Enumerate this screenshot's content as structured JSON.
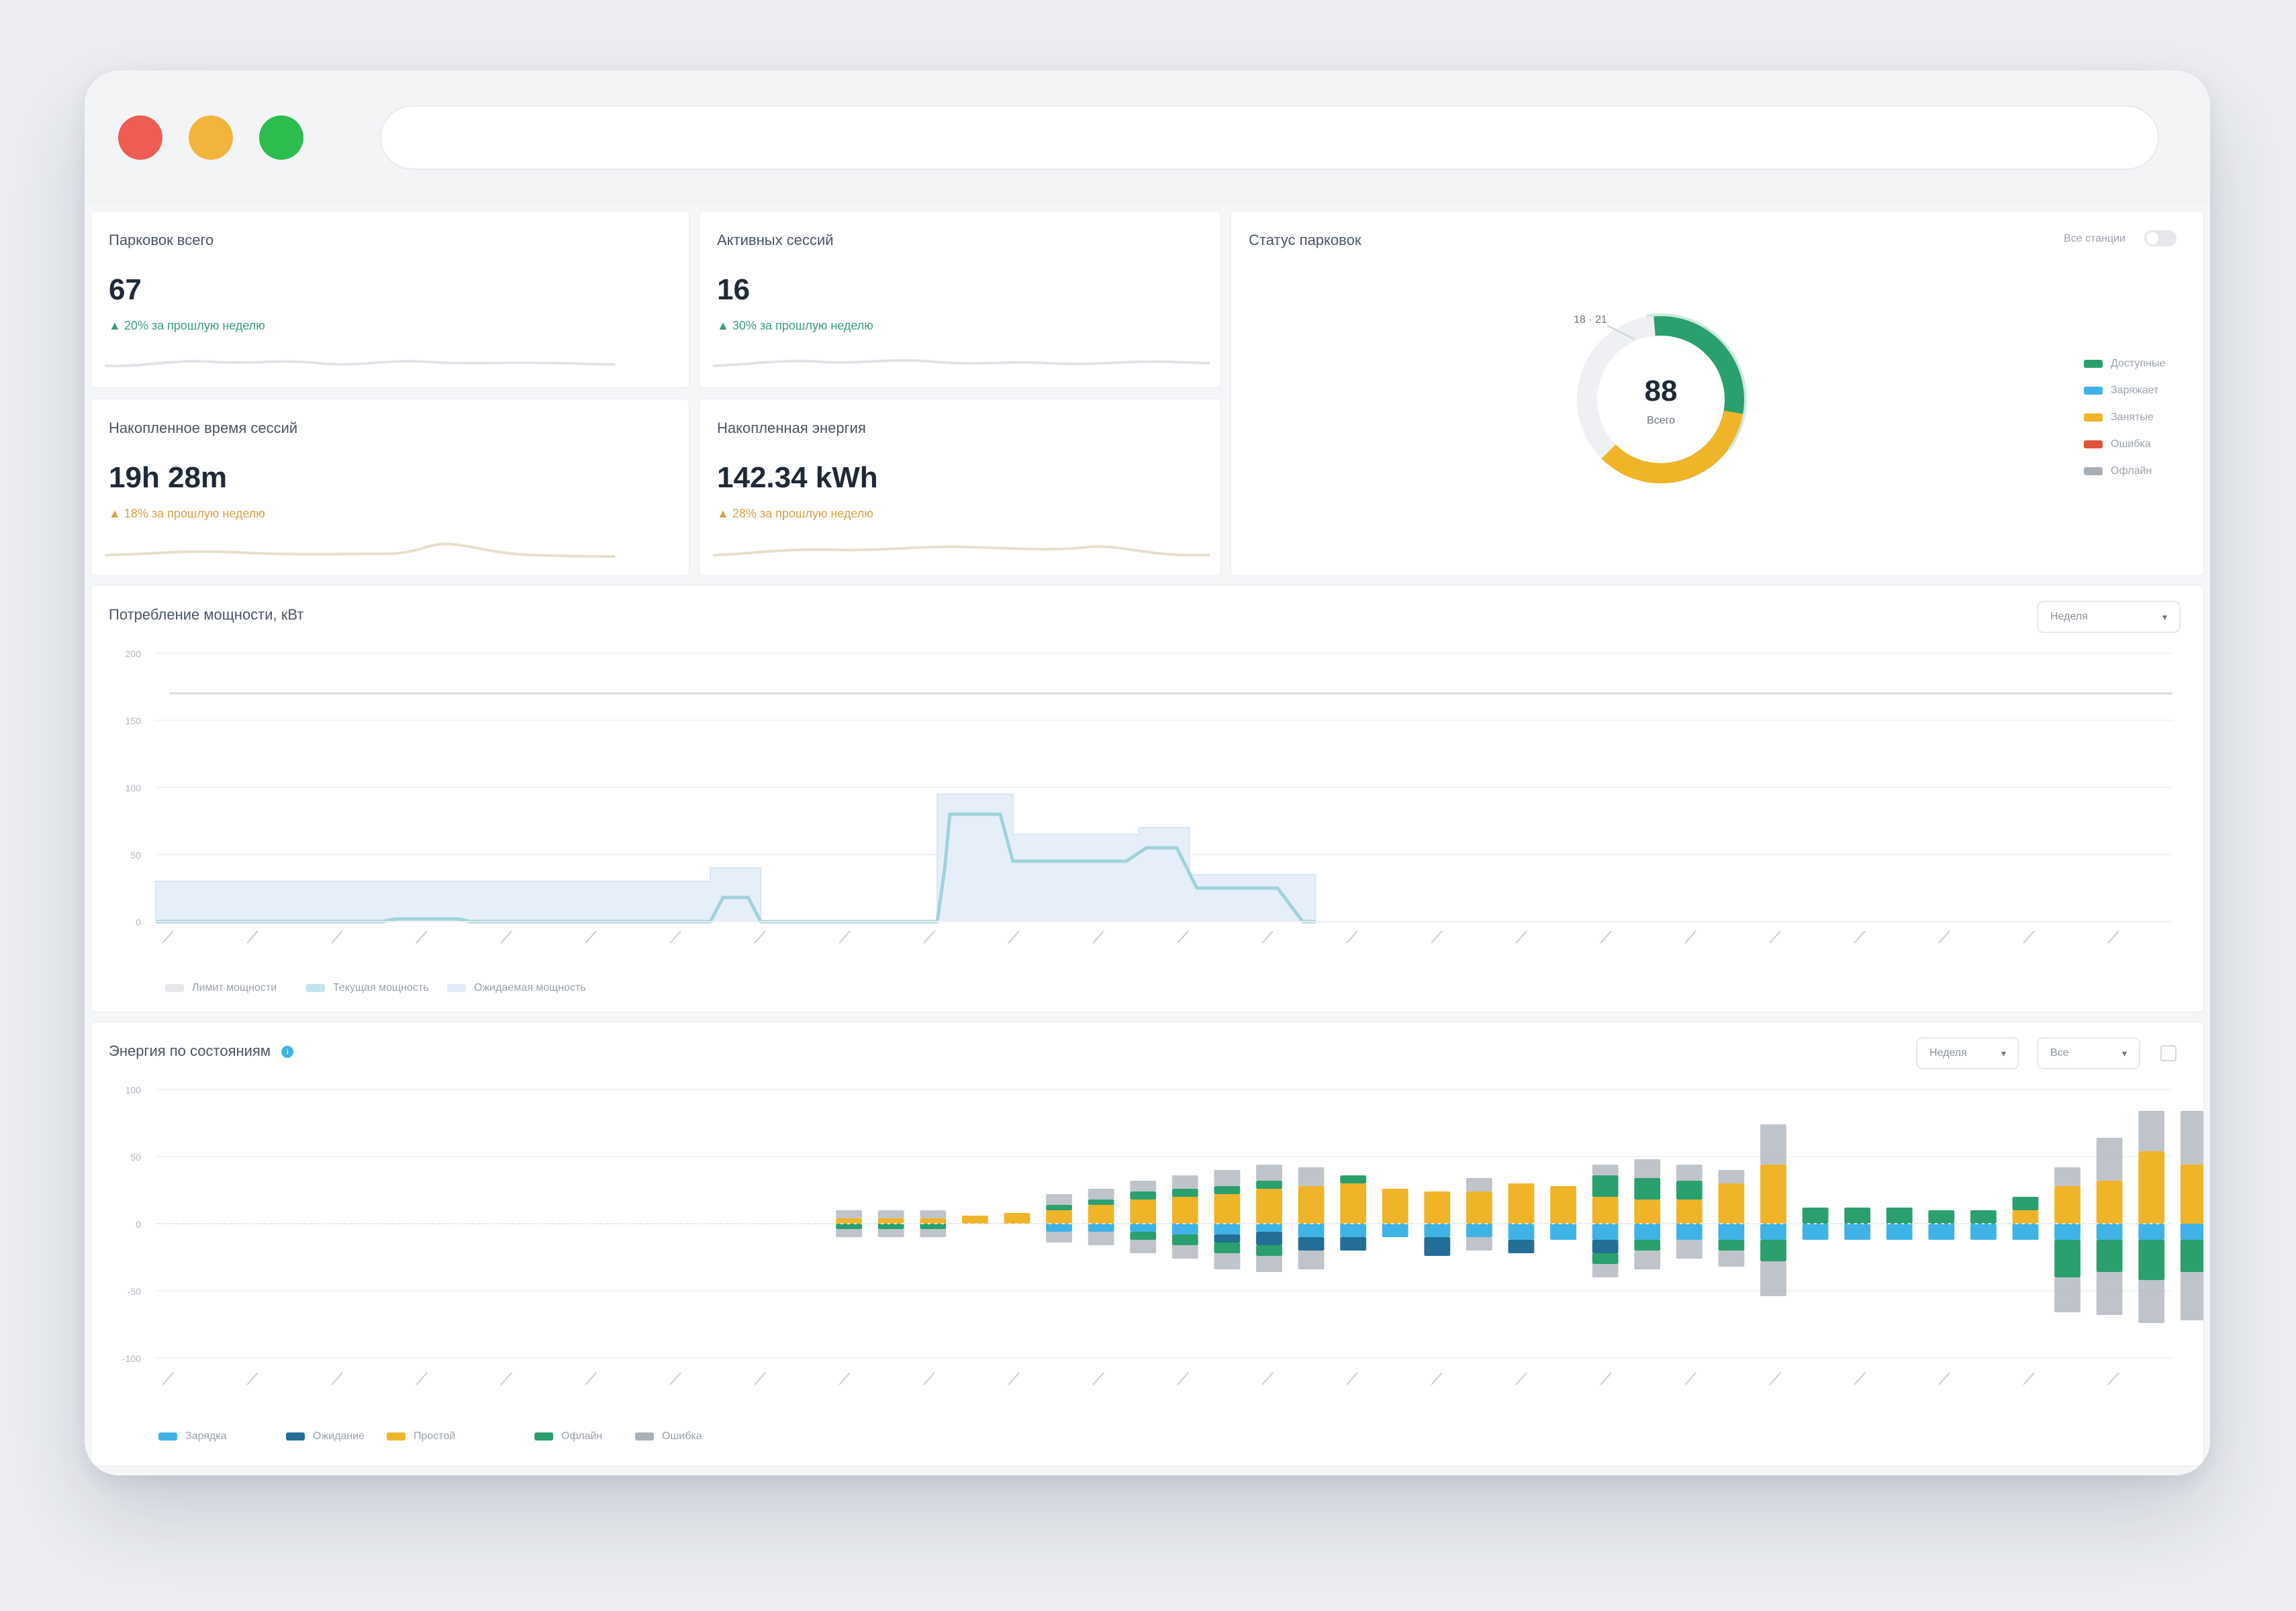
{
  "kpis": [
    {
      "title": "Парковок всего",
      "value": "67",
      "delta": "20% за прошлую неделю",
      "trend": "good"
    },
    {
      "title": "Активных сессий",
      "value": "16",
      "delta": "30% за прошлую неделю",
      "trend": "good"
    },
    {
      "title": "Накопленное время сессий",
      "value": "19h 28m",
      "delta": "18% за прошлую неделю",
      "trend": "warn"
    },
    {
      "title": "Накопленная энергия",
      "value": "142.34 kWh",
      "delta": "28% за прошлую неделю",
      "trend": "warn"
    }
  ],
  "status_card": {
    "title": "Статус парковок",
    "toggle_label": "Все станции",
    "donut_center": "88",
    "donut_caption": "Всего",
    "callout": "18 · 21",
    "legend": [
      "Доступные",
      "Заряжает",
      "Занятые",
      "Ошибка",
      "Офлайн"
    ],
    "colors": [
      "#2aa06f",
      "#3fb3e6",
      "#f0b429",
      "#e0533a",
      "#aab0b8"
    ]
  },
  "power_chart": {
    "title": "Потребление мощности, кВт",
    "select_value": "Неделя",
    "legend": [
      "Лимит мощности",
      "Текущая мощность",
      "Ожидаемая мощность"
    ]
  },
  "energy_chart": {
    "title": "Энергия по состояниям",
    "select1_value": "Неделя",
    "select2_value": "Все",
    "legend": [
      "Зарядка",
      "Ожидание",
      "Простой",
      "Офлайн",
      "Ошибка"
    ],
    "colors": [
      "#3fb3e6",
      "#236e96",
      "#f0b429",
      "#2aa06f",
      "#aab0b8"
    ]
  },
  "chart_data": [
    {
      "type": "area",
      "title": "Потребление мощности, кВт",
      "yticks": [
        "200",
        "150",
        "100",
        "50",
        "0"
      ],
      "ylim": [
        0,
        200
      ],
      "limit": 170,
      "x": [
        0,
        1,
        2,
        3,
        4,
        5,
        6,
        7,
        8,
        9,
        10,
        11,
        12,
        13,
        14,
        15,
        16,
        17,
        18,
        19,
        20,
        21,
        22,
        23,
        24,
        25,
        26,
        27,
        28,
        29,
        30,
        31,
        32,
        33,
        34,
        35,
        36,
        37,
        38,
        39,
        40,
        41,
        42,
        43,
        44,
        45,
        46,
        47,
        48,
        49,
        50,
        51,
        52,
        53,
        54,
        55,
        56,
        57,
        58,
        59,
        60,
        61,
        62,
        63,
        64,
        65,
        66,
        67,
        68,
        69,
        70,
        71,
        72,
        73,
        74,
        75,
        76,
        77,
        78,
        79,
        80
      ],
      "series": [
        {
          "name": "Текущая мощность",
          "values": [
            0,
            0,
            0,
            0,
            0,
            0,
            0,
            0,
            0,
            0,
            0,
            0,
            0,
            0,
            0,
            0,
            0,
            0,
            0,
            0,
            0,
            0,
            0,
            0,
            0,
            0,
            0,
            0,
            0,
            0,
            0,
            0,
            0,
            0,
            0,
            0,
            0,
            0,
            0,
            0,
            0,
            0,
            0,
            0,
            0,
            0,
            0,
            0,
            0,
            0,
            0,
            0,
            0,
            0,
            0,
            0,
            0,
            0,
            0,
            0,
            0,
            0,
            0,
            0,
            0,
            0,
            0,
            0,
            0,
            0,
            0,
            0,
            0,
            0,
            0,
            0,
            0,
            0,
            0,
            0,
            0
          ]
        },
        {
          "name": "Ожидаемая мощность",
          "values": [
            0,
            0,
            0,
            0,
            0,
            0,
            0,
            0,
            0,
            0,
            0,
            0,
            0,
            0,
            0,
            0,
            0,
            0,
            0,
            0,
            0,
            0,
            0,
            0,
            0,
            0,
            0,
            0,
            0,
            0,
            0,
            0,
            0,
            0,
            0,
            0,
            0,
            0,
            0,
            0,
            0,
            0,
            0,
            0,
            0,
            0,
            0,
            0,
            0,
            0,
            0,
            0,
            0,
            0,
            0,
            0,
            0,
            0,
            0,
            0,
            0,
            0,
            0,
            0,
            0,
            0,
            0,
            0,
            0,
            0,
            0,
            0,
            0,
            0,
            0,
            0,
            0,
            0,
            0,
            0,
            0
          ]
        }
      ],
      "current_segments": [
        [
          0,
          0
        ],
        [
          9,
          0
        ],
        [
          9.5,
          2
        ],
        [
          12,
          2
        ],
        [
          12.5,
          0
        ],
        [
          22,
          0
        ],
        [
          22.5,
          18
        ],
        [
          23.5,
          18
        ],
        [
          24,
          0
        ],
        [
          31,
          0
        ],
        [
          31.3,
          40
        ],
        [
          31.5,
          80
        ],
        [
          33.5,
          80
        ],
        [
          34,
          45
        ],
        [
          38.5,
          45
        ],
        [
          39.3,
          55
        ],
        [
          40.5,
          55
        ],
        [
          41.3,
          25
        ],
        [
          44.5,
          25
        ],
        [
          45.5,
          0
        ],
        [
          46,
          0
        ]
      ],
      "expected_segments": [
        [
          0,
          30
        ],
        [
          22,
          30
        ],
        [
          22,
          40
        ],
        [
          24,
          40
        ],
        [
          24,
          0
        ],
        [
          31,
          0
        ],
        [
          31,
          95
        ],
        [
          34,
          95
        ],
        [
          34,
          65
        ],
        [
          39,
          65
        ],
        [
          39,
          70
        ],
        [
          41,
          70
        ],
        [
          41,
          35
        ],
        [
          46,
          35
        ],
        [
          46,
          0
        ]
      ]
    },
    {
      "type": "bar",
      "title": "Энергия по состояниям",
      "yticks": [
        "100",
        "50",
        "0",
        "-50",
        "-100"
      ],
      "ylim": [
        -100,
        100
      ],
      "bars": [
        {
          "up": [
            0,
            0,
            4,
            0,
            6
          ],
          "down": [
            0,
            0,
            0,
            4,
            6
          ]
        },
        {
          "up": [
            0,
            0,
            4,
            0,
            6
          ],
          "down": [
            0,
            0,
            0,
            4,
            6
          ]
        },
        {
          "up": [
            0,
            0,
            4,
            0,
            6
          ],
          "down": [
            0,
            0,
            0,
            4,
            6
          ]
        },
        {
          "up": [
            0,
            0,
            6,
            0,
            0
          ],
          "down": [
            0,
            0,
            0,
            0,
            0
          ]
        },
        {
          "up": [
            0,
            0,
            8,
            0,
            0
          ],
          "down": [
            0,
            0,
            0,
            0,
            0
          ]
        },
        {
          "up": [
            0,
            0,
            10,
            4,
            8
          ],
          "down": [
            6,
            0,
            0,
            0,
            8
          ]
        },
        {
          "up": [
            0,
            0,
            14,
            4,
            8
          ],
          "down": [
            6,
            0,
            0,
            0,
            10
          ]
        },
        {
          "up": [
            0,
            0,
            18,
            6,
            8
          ],
          "down": [
            6,
            0,
            0,
            6,
            10
          ]
        },
        {
          "up": [
            0,
            0,
            20,
            6,
            10
          ],
          "down": [
            8,
            0,
            0,
            8,
            10
          ]
        },
        {
          "up": [
            0,
            0,
            22,
            6,
            12
          ],
          "down": [
            8,
            6,
            0,
            8,
            12
          ]
        },
        {
          "up": [
            0,
            0,
            26,
            6,
            12
          ],
          "down": [
            6,
            10,
            0,
            8,
            12
          ]
        },
        {
          "up": [
            0,
            0,
            28,
            0,
            14
          ],
          "down": [
            10,
            10,
            0,
            0,
            14
          ]
        },
        {
          "up": [
            0,
            0,
            30,
            6,
            0
          ],
          "down": [
            10,
            10,
            0,
            0,
            0
          ]
        },
        {
          "up": [
            0,
            0,
            26,
            0,
            0
          ],
          "down": [
            10,
            0,
            0,
            0,
            0
          ]
        },
        {
          "up": [
            0,
            0,
            24,
            0,
            0
          ],
          "down": [
            10,
            14,
            0,
            0,
            0
          ]
        },
        {
          "up": [
            0,
            0,
            24,
            0,
            10
          ],
          "down": [
            10,
            0,
            0,
            0,
            10
          ]
        },
        {
          "up": [
            0,
            0,
            30,
            0,
            0
          ],
          "down": [
            12,
            10,
            0,
            0,
            0
          ]
        },
        {
          "up": [
            0,
            0,
            28,
            0,
            0
          ],
          "down": [
            12,
            0,
            0,
            0,
            0
          ]
        },
        {
          "up": [
            0,
            0,
            20,
            16,
            8
          ],
          "down": [
            12,
            10,
            0,
            8,
            10
          ]
        },
        {
          "up": [
            0,
            0,
            18,
            16,
            14
          ],
          "down": [
            12,
            0,
            0,
            8,
            14
          ]
        },
        {
          "up": [
            0,
            0,
            18,
            14,
            12
          ],
          "down": [
            12,
            0,
            0,
            0,
            14
          ]
        },
        {
          "up": [
            0,
            0,
            30,
            0,
            10
          ],
          "down": [
            12,
            0,
            0,
            8,
            12
          ]
        },
        {
          "up": [
            0,
            0,
            44,
            0,
            30
          ],
          "down": [
            12,
            0,
            0,
            16,
            26
          ]
        },
        {
          "up": [
            0,
            0,
            0,
            12,
            0
          ],
          "down": [
            12,
            0,
            0,
            0,
            0
          ]
        },
        {
          "up": [
            0,
            0,
            0,
            12,
            0
          ],
          "down": [
            12,
            0,
            0,
            0,
            0
          ]
        },
        {
          "up": [
            0,
            0,
            0,
            12,
            0
          ],
          "down": [
            12,
            0,
            0,
            0,
            0
          ]
        },
        {
          "up": [
            0,
            0,
            0,
            10,
            0
          ],
          "down": [
            12,
            0,
            0,
            0,
            0
          ]
        },
        {
          "up": [
            0,
            0,
            0,
            10,
            0
          ],
          "down": [
            12,
            0,
            0,
            0,
            0
          ]
        },
        {
          "up": [
            0,
            0,
            10,
            10,
            0
          ],
          "down": [
            12,
            0,
            0,
            0,
            0
          ]
        },
        {
          "up": [
            0,
            0,
            28,
            0,
            14
          ],
          "down": [
            12,
            0,
            0,
            28,
            26
          ]
        },
        {
          "up": [
            0,
            0,
            32,
            0,
            32
          ],
          "down": [
            12,
            0,
            0,
            24,
            32
          ]
        },
        {
          "up": [
            0,
            0,
            54,
            0,
            30
          ],
          "down": [
            12,
            0,
            0,
            30,
            32
          ]
        },
        {
          "up": [
            0,
            0,
            44,
            0,
            40
          ],
          "down": [
            12,
            0,
            0,
            24,
            36
          ]
        },
        {
          "up": [
            0,
            0,
            36,
            0,
            28
          ],
          "down": [
            12,
            28,
            0,
            0,
            24
          ]
        }
      ],
      "bar_start_index": 16,
      "bar_count_total": 48
    }
  ]
}
